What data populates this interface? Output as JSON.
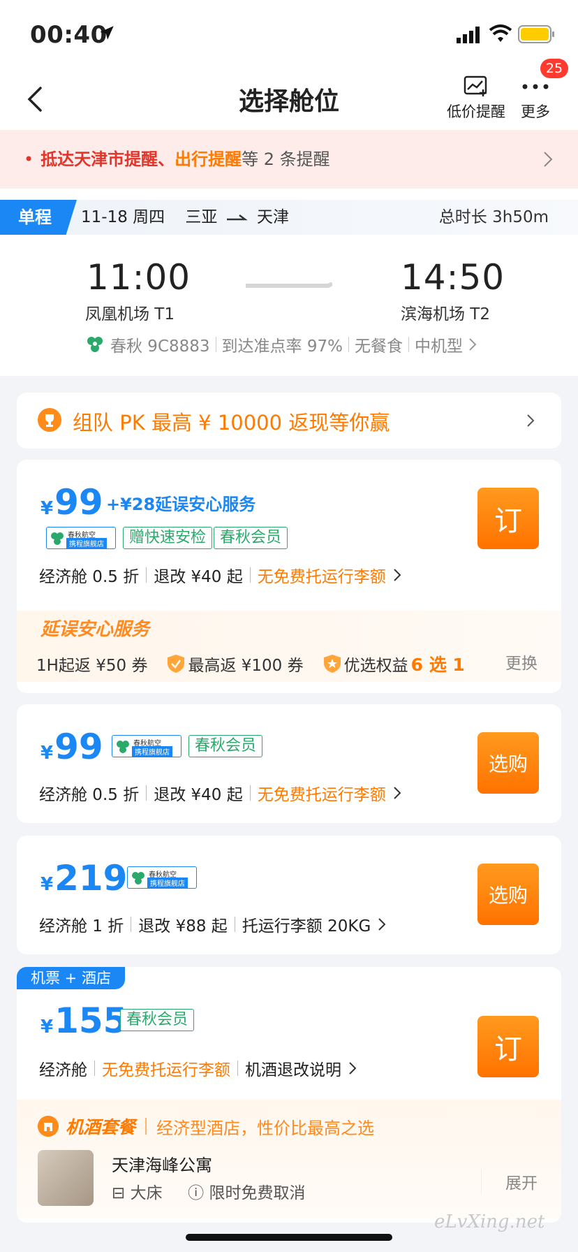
{
  "status": {
    "time": "00:40"
  },
  "nav": {
    "title": "选择舱位",
    "low_price_label": "低价提醒",
    "more_label": "更多",
    "badge": "25"
  },
  "reminder": {
    "part1": "抵达天津市提醒",
    "part2": "、",
    "part3": "出行提醒",
    "part4": "等 2 条提醒"
  },
  "flight": {
    "trip_type": "单程",
    "date": "11-18 周四",
    "from_city": "三亚",
    "to_city": "天津",
    "duration": "总时长 3h50m",
    "dep_time": "11:00",
    "arr_time": "14:50",
    "dep_airport": "凤凰机场 T1",
    "arr_airport": "滨海机场 T2",
    "airline_flight": "春秋 9C8883",
    "on_time": "到达准点率 97%",
    "meal": "无餐食",
    "aircraft": "中机型"
  },
  "promo": {
    "text": "组队 PK 最高 ¥ 10000 返现等你赢"
  },
  "cards": [
    {
      "yen": "¥",
      "price": "99",
      "addon": "+¥28延误安心服务",
      "airtag_top": "春秋航空",
      "airtag_bot": "携程旗舰店",
      "tags": [
        "赠快速安检",
        "春秋会员"
      ],
      "cabin": "经济舱 0.5 折",
      "refund": "退改 ¥40 起",
      "baggage": "无免费托运行李额",
      "button": "订",
      "delay_title": "延误安心服务",
      "delay_items": [
        "1H起返 ¥50 券",
        "最高返 ¥100 券",
        "优选权益"
      ],
      "delay_bold": "6 选 1",
      "swap": "更换"
    },
    {
      "yen": "¥",
      "price": "99",
      "airtag_top": "春秋航空",
      "airtag_bot": "携程旗舰店",
      "tags": [
        "春秋会员"
      ],
      "cabin": "经济舱 0.5 折",
      "refund": "退改 ¥40 起",
      "baggage": "无免费托运行李额",
      "button": "选购"
    },
    {
      "yen": "¥",
      "price": "219",
      "airtag_top": "春秋航空",
      "airtag_bot": "携程旗舰店",
      "cabin": "经济舱 1 折",
      "refund": "退改 ¥88 起",
      "baggage": "托运行李额 20KG",
      "button": "选购"
    },
    {
      "combo_label": "机票 + 酒店",
      "yen": "¥",
      "price": "155",
      "tags": [
        "春秋会员"
      ],
      "cabin": "经济舱",
      "baggage": "无免费托运行李额",
      "note": "机酒退改说明",
      "button": "订",
      "pkg_title": "机酒套餐",
      "pkg_desc": "经济型酒店，性价比最高之选",
      "hotel_name": "天津海峰公寓",
      "bed": "大床",
      "cancel": "限时免费取消",
      "expand": "展开"
    }
  ],
  "watermark": "eLvXing.net",
  "colors": {
    "accent": "#1a87f5",
    "orange": "#ff7a00",
    "green": "#2aa96b",
    "alert_red": "#e0362c"
  }
}
